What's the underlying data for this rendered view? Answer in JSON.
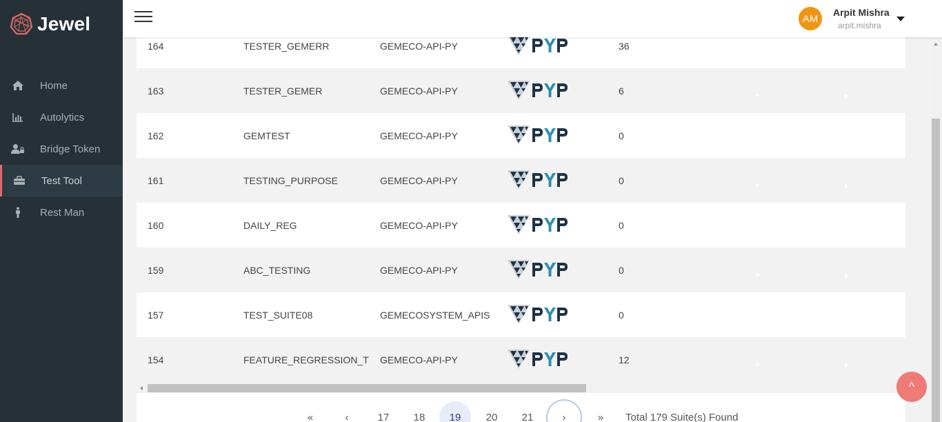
{
  "brand": {
    "name": "Jewel"
  },
  "sidebar": {
    "items": [
      {
        "label": "Home",
        "icon": "home-icon"
      },
      {
        "label": "Autolytics",
        "icon": "bar-chart-icon"
      },
      {
        "label": "Bridge Token",
        "icon": "user-lock-icon"
      },
      {
        "label": "Test Tool",
        "icon": "toolbox-icon",
        "active": true
      },
      {
        "label": "Rest Man",
        "icon": "person-icon"
      }
    ]
  },
  "header": {
    "user": {
      "initials": "AM",
      "name": "Arpit Mishra",
      "handle": "arpit.mishra"
    }
  },
  "table": {
    "rows": [
      {
        "id": "164",
        "name": "TESTER_GEMERR",
        "project": "GEMECO-API-PY",
        "count": "36"
      },
      {
        "id": "163",
        "name": "TESTER_GEMER",
        "project": "GEMECO-API-PY",
        "count": "6"
      },
      {
        "id": "162",
        "name": "GEMTEST",
        "project": "GEMECO-API-PY",
        "count": "0"
      },
      {
        "id": "161",
        "name": "TESTING_PURPOSE",
        "project": "GEMECO-API-PY",
        "count": "0"
      },
      {
        "id": "160",
        "name": "DAILY_REG",
        "project": "GEMECO-API-PY",
        "count": "0"
      },
      {
        "id": "159",
        "name": "ABC_TESTING",
        "project": "GEMECO-API-PY",
        "count": "0"
      },
      {
        "id": "157",
        "name": "TEST_SUITE08",
        "project": "GEMECOSYSTEM_APIS",
        "count": "0"
      },
      {
        "id": "154",
        "name": "FEATURE_REGRESSION_T",
        "project": "GEMECO-API-PY",
        "count": "12"
      }
    ]
  },
  "pagination": {
    "first": "«",
    "prev": "‹",
    "pages": [
      "17",
      "18",
      "19",
      "20",
      "21"
    ],
    "current": "19",
    "next": "›",
    "last": "»",
    "total_text": "Total 179 Suite(s) Found"
  },
  "back_to_top": {
    "label": "^"
  },
  "colors": {
    "sidebar": "#253137",
    "accent": "#e46a6a",
    "avatar": "#f29411",
    "action": "#1c3e5c"
  }
}
